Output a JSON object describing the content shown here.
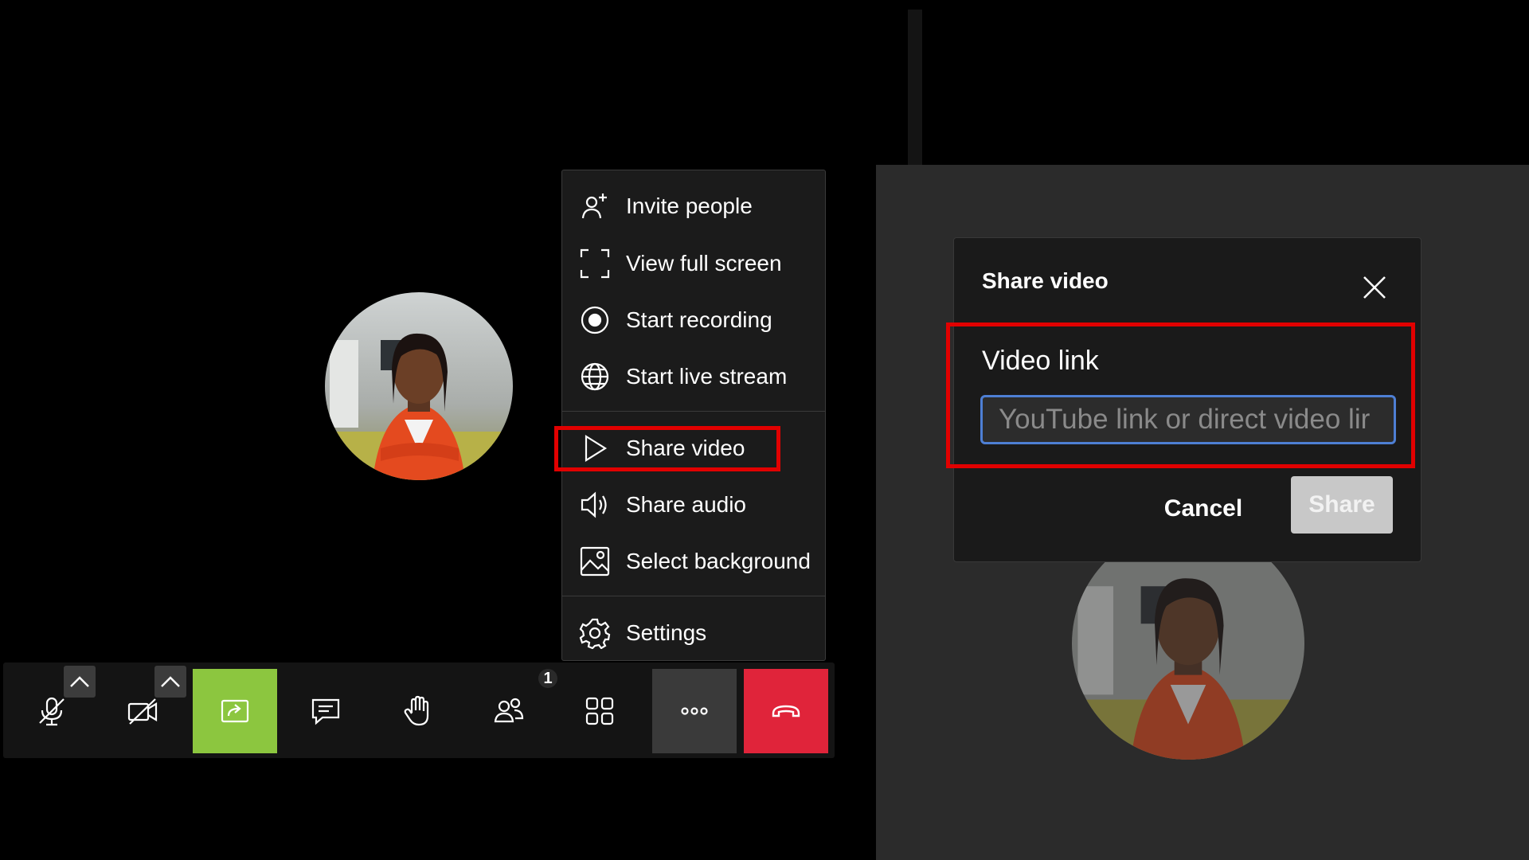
{
  "colors": {
    "highlight": "#e10000",
    "share_screen_active": "#8cc63f",
    "hangup": "#e0243a",
    "input_focus": "#4e7fd4"
  },
  "more_menu": {
    "items": [
      {
        "label": "Invite people",
        "icon": "invite-people-icon"
      },
      {
        "label": "View full screen",
        "icon": "fullscreen-icon"
      },
      {
        "label": "Start recording",
        "icon": "record-icon"
      },
      {
        "label": "Start live stream",
        "icon": "globe-icon"
      },
      {
        "label": "Share video",
        "icon": "play-icon"
      },
      {
        "label": "Share audio",
        "icon": "speaker-icon"
      },
      {
        "label": "Select background",
        "icon": "image-icon"
      },
      {
        "label": "Settings",
        "icon": "gear-icon"
      }
    ],
    "highlighted": "Share video"
  },
  "toolbar": {
    "buttons": [
      {
        "name": "microphone",
        "icon": "mic-off-icon"
      },
      {
        "name": "camera",
        "icon": "camera-off-icon"
      },
      {
        "name": "share-screen",
        "icon": "share-screen-icon",
        "active": true
      },
      {
        "name": "chat",
        "icon": "chat-icon"
      },
      {
        "name": "raise-hand",
        "icon": "hand-icon"
      },
      {
        "name": "participants",
        "icon": "participants-icon"
      },
      {
        "name": "tile-view",
        "icon": "grid-icon"
      },
      {
        "name": "more-actions",
        "icon": "more-icon"
      },
      {
        "name": "leave",
        "icon": "hangup-icon"
      }
    ],
    "participants_count": "1"
  },
  "share_video_dialog": {
    "title": "Share video",
    "field_label": "Video link",
    "placeholder": "YouTube link or direct video lir",
    "value": "",
    "cancel_label": "Cancel",
    "share_label": "Share"
  }
}
